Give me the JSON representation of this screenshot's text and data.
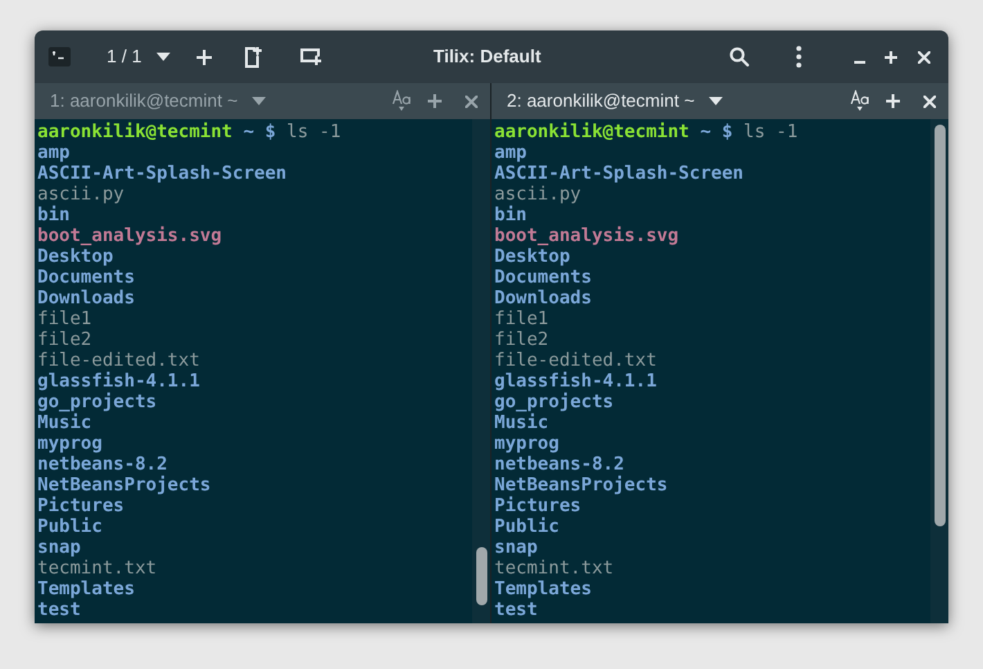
{
  "window": {
    "title": "Tilix: Default",
    "session_counter": "1 / 1"
  },
  "panes": [
    {
      "tab_title": "1: aaronkilik@tecmint ~",
      "selected": false,
      "prompt": {
        "user_host": "aaronkilik@tecmint",
        "path": "~",
        "symbol": "$",
        "command": "ls -1"
      },
      "entries": [
        {
          "name": "amp",
          "kind": "dir"
        },
        {
          "name": "ASCII-Art-Splash-Screen",
          "kind": "dir"
        },
        {
          "name": "ascii.py",
          "kind": "file"
        },
        {
          "name": "bin",
          "kind": "dir"
        },
        {
          "name": "boot_analysis.svg",
          "kind": "image"
        },
        {
          "name": "Desktop",
          "kind": "dir"
        },
        {
          "name": "Documents",
          "kind": "dir"
        },
        {
          "name": "Downloads",
          "kind": "dir"
        },
        {
          "name": "file1",
          "kind": "file"
        },
        {
          "name": "file2",
          "kind": "file"
        },
        {
          "name": "file-edited.txt",
          "kind": "file"
        },
        {
          "name": "glassfish-4.1.1",
          "kind": "dir"
        },
        {
          "name": "go_projects",
          "kind": "dir"
        },
        {
          "name": "Music",
          "kind": "dir"
        },
        {
          "name": "myprog",
          "kind": "dir"
        },
        {
          "name": "netbeans-8.2",
          "kind": "dir"
        },
        {
          "name": "NetBeansProjects",
          "kind": "dir"
        },
        {
          "name": "Pictures",
          "kind": "dir"
        },
        {
          "name": "Public",
          "kind": "dir"
        },
        {
          "name": "snap",
          "kind": "dir"
        },
        {
          "name": "tecmint.txt",
          "kind": "file"
        },
        {
          "name": "Templates",
          "kind": "dir"
        },
        {
          "name": "test",
          "kind": "dir"
        }
      ]
    },
    {
      "tab_title": "2: aaronkilik@tecmint ~",
      "selected": true,
      "prompt": {
        "user_host": "aaronkilik@tecmint",
        "path": "~",
        "symbol": "$",
        "command": "ls -1"
      },
      "entries": [
        {
          "name": "amp",
          "kind": "dir"
        },
        {
          "name": "ASCII-Art-Splash-Screen",
          "kind": "dir"
        },
        {
          "name": "ascii.py",
          "kind": "file"
        },
        {
          "name": "bin",
          "kind": "dir"
        },
        {
          "name": "boot_analysis.svg",
          "kind": "image"
        },
        {
          "name": "Desktop",
          "kind": "dir"
        },
        {
          "name": "Documents",
          "kind": "dir"
        },
        {
          "name": "Downloads",
          "kind": "dir"
        },
        {
          "name": "file1",
          "kind": "file"
        },
        {
          "name": "file2",
          "kind": "file"
        },
        {
          "name": "file-edited.txt",
          "kind": "file"
        },
        {
          "name": "glassfish-4.1.1",
          "kind": "dir"
        },
        {
          "name": "go_projects",
          "kind": "dir"
        },
        {
          "name": "Music",
          "kind": "dir"
        },
        {
          "name": "myprog",
          "kind": "dir"
        },
        {
          "name": "netbeans-8.2",
          "kind": "dir"
        },
        {
          "name": "NetBeansProjects",
          "kind": "dir"
        },
        {
          "name": "Pictures",
          "kind": "dir"
        },
        {
          "name": "Public",
          "kind": "dir"
        },
        {
          "name": "snap",
          "kind": "dir"
        },
        {
          "name": "tecmint.txt",
          "kind": "file"
        },
        {
          "name": "Templates",
          "kind": "dir"
        },
        {
          "name": "test",
          "kind": "dir"
        }
      ]
    }
  ]
}
